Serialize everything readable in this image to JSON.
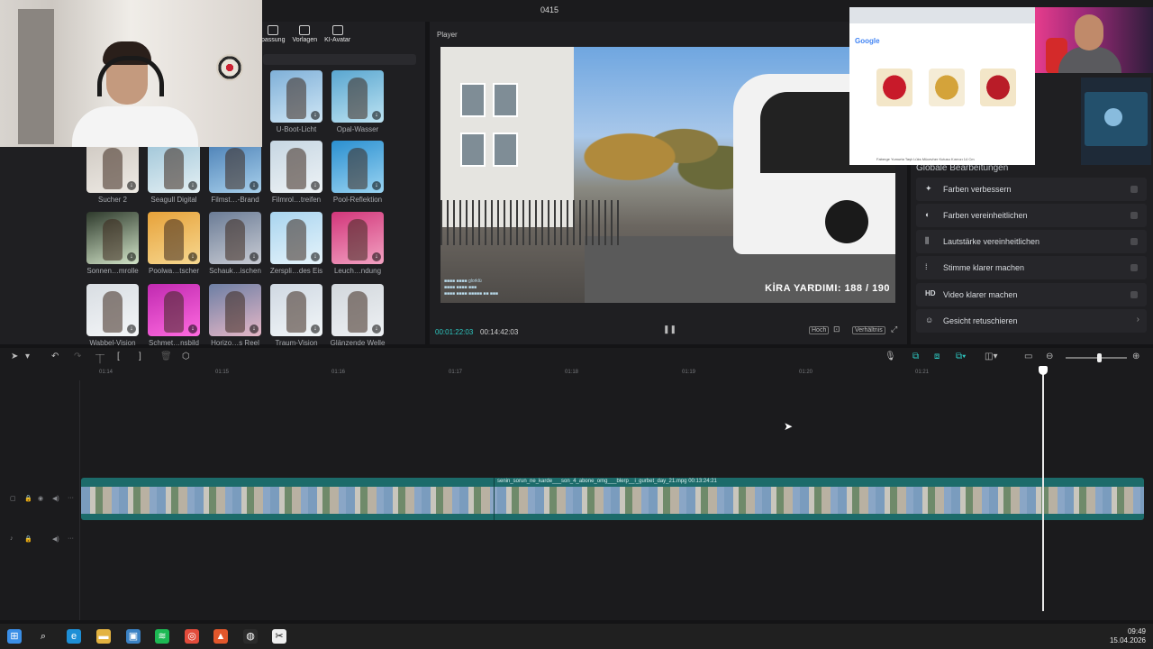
{
  "window": {
    "title": "0415"
  },
  "media_panel": {
    "tabs": [
      {
        "label": "passung",
        "icon": "adjust-icon"
      },
      {
        "label": "Vorlagen",
        "icon": "template-icon"
      },
      {
        "label": "KI-Avatar",
        "icon": "avatar-icon"
      }
    ],
    "items": [
      {
        "label": "U-Boot-Licht",
        "colors": [
          "#7fb0d8",
          "#cfe6f5"
        ]
      },
      {
        "label": "Opal-Wasser",
        "colors": [
          "#59a6d0",
          "#bde3f2"
        ]
      },
      {
        "label": "Sucher 2",
        "colors": [
          "#cfc9c2",
          "#eeeae4"
        ]
      },
      {
        "label": "Seagull Digital",
        "colors": [
          "#9fc5d8",
          "#e4f0f4"
        ]
      },
      {
        "label": "Filmst…-Brand",
        "colors": [
          "#4a7fb5",
          "#a8d0ec"
        ]
      },
      {
        "label": "Filmrol…treifen",
        "colors": [
          "#c6d6e2",
          "#eef3f6"
        ]
      },
      {
        "label": "Pool-Reflektion",
        "colors": [
          "#2a8fd0",
          "#9ad4f2"
        ]
      },
      {
        "label": "Sonnen…mrolle",
        "colors": [
          "#2e3a2c",
          "#d2e4c8"
        ]
      },
      {
        "label": "Poolwa…tscher",
        "colors": [
          "#e7a23a",
          "#f7d890"
        ]
      },
      {
        "label": "Schauk…ischen",
        "colors": [
          "#6b7c96",
          "#c9ccd4"
        ]
      },
      {
        "label": "Zerspli…des Eis",
        "colors": [
          "#a8d4ef",
          "#e6f4fb"
        ]
      },
      {
        "label": "Leuch…ndung",
        "colors": [
          "#d2367a",
          "#f2a2c2"
        ]
      },
      {
        "label": "Wabbel-Vision",
        "colors": [
          "#d8dde2",
          "#f4f6f8"
        ]
      },
      {
        "label": "Schmet…nsbild",
        "colors": [
          "#c02ab0",
          "#ff6ae0"
        ]
      },
      {
        "label": "Horizo…s Reel",
        "colors": [
          "#6d7fa4",
          "#e6b7c7"
        ]
      },
      {
        "label": "Traum-Vision",
        "colors": [
          "#cfd8e2",
          "#f2f6f8"
        ]
      },
      {
        "label": "Glänzende Welle",
        "colors": [
          "#d2d7dc",
          "#eef1f4"
        ]
      }
    ]
  },
  "player": {
    "label": "Player",
    "current_time": "00:01:22:03",
    "total_time": "00:14:42:03",
    "overlay_text": "KİRA YARDIMI:  188 / 190",
    "buttons": {
      "hoch": "Hoch",
      "verhaeltnis": "Verhältnis"
    },
    "chat_lines": [
      "■■■■ ■■■■ glorklü",
      "■■■■ ■■■■ ■■■",
      "■■■■ ■■■■ ■■■■■ ■■ ■■■"
    ]
  },
  "properties": {
    "section_title": "Globale Bearbeitungen",
    "items": [
      {
        "label": "Farben verbessern",
        "icon": "magic-wand-icon",
        "control": "toggle"
      },
      {
        "label": "Farben vereinheitlichen",
        "icon": "color-sync-icon",
        "control": "toggle"
      },
      {
        "label": "Lautstärke vereinheitlichen",
        "icon": "volume-sliders-icon",
        "control": "toggle"
      },
      {
        "label": "Stimme klarer machen",
        "icon": "voice-icon",
        "control": "toggle"
      },
      {
        "label": "Video klarer machen",
        "icon": "hd-icon",
        "control": "toggle"
      },
      {
        "label": "Gesicht retuschieren",
        "icon": "face-icon",
        "control": "chevron"
      }
    ]
  },
  "browser_overlay": {
    "logo": "Google",
    "caption": "Faberge Yumurta Taşlı Lüks Mücevher Kutusu Kırmızı 14 Cm"
  },
  "timeline": {
    "ruler": [
      "01:14",
      "01:15",
      "01:16",
      "01:17",
      "01:18",
      "01:19",
      "01:20",
      "01:21"
    ],
    "clip_name": "senin_sorun_ne_karde___son_4_abone_omg___blerp__i_gurbet_day_21.mpg",
    "clip_duration": "00:13:24:21"
  },
  "taskbar": {
    "time": "09:49",
    "date": "15.04.2026",
    "apps": [
      {
        "name": "windows-start",
        "color": "#3a8ee6"
      },
      {
        "name": "search",
        "color": "#202020"
      },
      {
        "name": "edge",
        "color": "#1e8fd6"
      },
      {
        "name": "explorer",
        "color": "#e3b341"
      },
      {
        "name": "store",
        "color": "#3b82c4"
      },
      {
        "name": "spotify",
        "color": "#1db954"
      },
      {
        "name": "chrome",
        "color": "#e24b3b"
      },
      {
        "name": "brave",
        "color": "#e2572b"
      },
      {
        "name": "obs",
        "color": "#2b2b2b"
      },
      {
        "name": "capcut",
        "color": "#eeeeee"
      }
    ]
  }
}
